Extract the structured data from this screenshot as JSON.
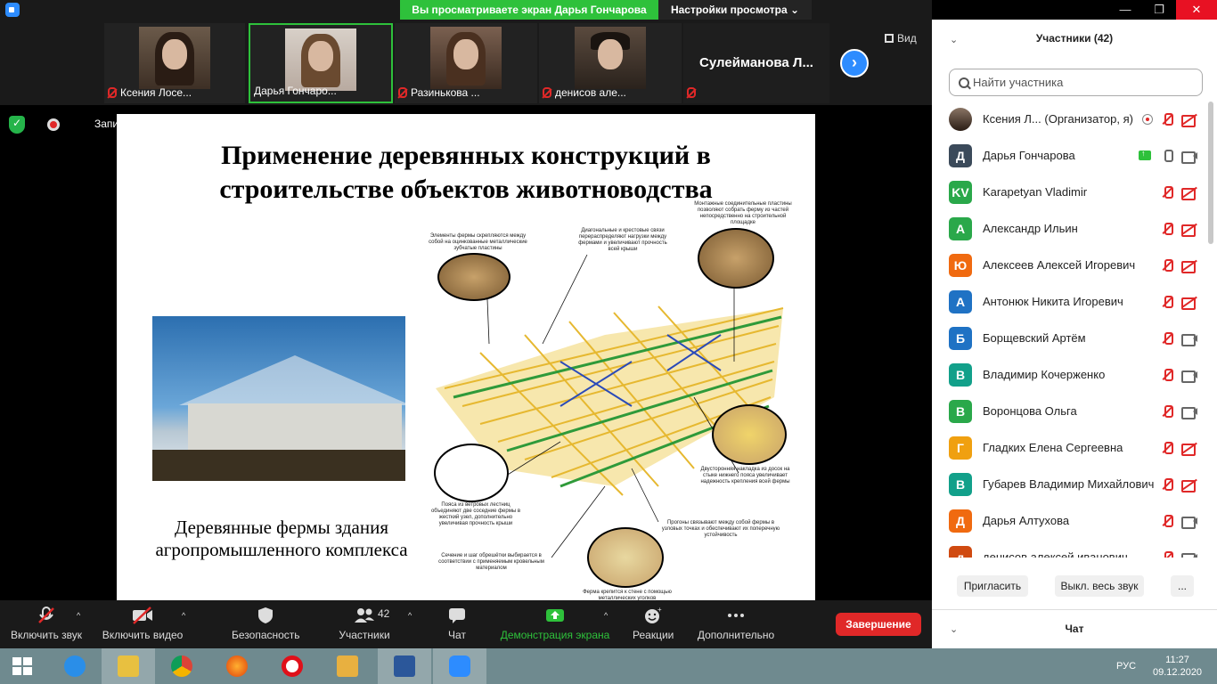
{
  "titlebar": {
    "share_banner": "Вы просматриваете экран Дарья Гончарова",
    "view_settings": "Настройки просмотра ⌄",
    "minimize": "—",
    "maximize": "❐",
    "close": "✕"
  },
  "video_strip": {
    "tiles": [
      {
        "name": "Ксения Лосе..."
      },
      {
        "name": "Дарья Гончаро..."
      },
      {
        "name": "Разинькова ..."
      },
      {
        "name": "денисов але..."
      },
      {
        "name": "Сулейманова  Л..."
      }
    ],
    "next": "›",
    "view_label": "Вид"
  },
  "recording": {
    "label": "Запись..."
  },
  "slide": {
    "title_line1": "Применение деревянных конструкций в",
    "title_line2": "строительстве объектов животноводства",
    "caption_line1": "Деревянные фермы здания",
    "caption_line2": "агропромышленного комплекса",
    "notes": [
      "Монтажные соединительные пластины позволяют собрать ферму из частей непосредственно на строительной площадке",
      "Элементы фермы скрепляются между собой на оцинкованные металлические зубчатые пластины",
      "Диагональные и крестовые связи перераспределяют нагрузки между фермами и увеличивают прочность всей крыши",
      "Двусторонняя накладка из досок на стыке нижнего пояса увеличивает надежность крепления всей фермы",
      "Пояса из ветровых лестниц объединяют две соседние фермы в жесткий узел, дополнительно увеличивая прочность крыши",
      "Прогоны связывают между собой фермы в узловых точках и обеспечивают их поперечную устойчивость",
      "Сечение и шаг обрешётки выбирается в соответствии с применяемым кровельным материалом",
      "Ферма крепится к стене с помощью металлических уголков"
    ]
  },
  "toolbar": {
    "audio": "Включить звук",
    "video": "Включить видео",
    "security": "Безопасность",
    "participants": "Участники",
    "participants_count": "42",
    "chat": "Чат",
    "share": "Демонстрация экрана",
    "reactions": "Реакции",
    "more": "Дополнительно",
    "end": "Завершение"
  },
  "panel": {
    "title": "Участники (42)",
    "search_placeholder": "Найти участника",
    "participants": [
      {
        "name": "Ксения Л...  (Организатор, я)",
        "avatar": "",
        "color": "#8a7565",
        "mic": "off",
        "cam": "off"
      },
      {
        "name": "Дарья Гончарова",
        "avatar": "Д",
        "color": "#3b4a5a",
        "mic": "on",
        "cam": "on"
      },
      {
        "name": "Karapetyan Vladimir",
        "avatar": "KV",
        "color": "#2aa84a",
        "mic": "off",
        "cam": "off"
      },
      {
        "name": "Александр Ильин",
        "avatar": "А",
        "color": "#2aa84a",
        "mic": "off",
        "cam": "off"
      },
      {
        "name": "Алексеев Алексей Игоревич",
        "avatar": "Ю",
        "color": "#f06a10",
        "mic": "off",
        "cam": "off"
      },
      {
        "name": "Антонюк Никита Игоревич",
        "avatar": "А",
        "color": "#1f72c4",
        "mic": "off",
        "cam": "off"
      },
      {
        "name": "Борщевский Артём",
        "avatar": "Б",
        "color": "#1f72c4",
        "mic": "off",
        "cam": "on"
      },
      {
        "name": "Владимир Кочерженко",
        "avatar": "В",
        "color": "#12a08a",
        "mic": "off",
        "cam": "on"
      },
      {
        "name": "Воронцова Ольга",
        "avatar": "В",
        "color": "#2aa84a",
        "mic": "off",
        "cam": "on"
      },
      {
        "name": "Гладких Елена Сергеевна",
        "avatar": "Г",
        "color": "#f0a010",
        "mic": "off",
        "cam": "off"
      },
      {
        "name": "Губарев Владимир Михайлович",
        "avatar": "В",
        "color": "#12a08a",
        "mic": "off",
        "cam": "off"
      },
      {
        "name": "Дарья Алтухова",
        "avatar": "Д",
        "color": "#f06a10",
        "mic": "off",
        "cam": "on"
      },
      {
        "name": "денисов алексей иванович",
        "avatar": "д",
        "color": "#d04a10",
        "mic": "off",
        "cam": "on"
      }
    ],
    "invite": "Пригласить",
    "mute_all": "Выкл. весь звук",
    "more": "...",
    "chat_title": "Чат"
  },
  "taskbar": {
    "lang": "РУС",
    "time": "11:27",
    "date": "09.12.2020"
  }
}
